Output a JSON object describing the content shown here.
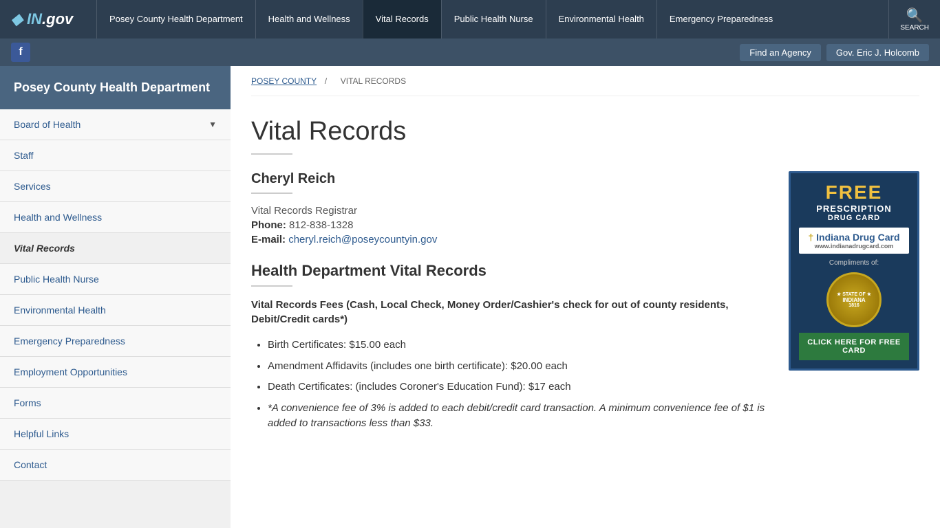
{
  "site": {
    "logo": "IN.gov",
    "logo_prefix": "IN",
    "logo_suffix": ".gov"
  },
  "top_nav": {
    "items": [
      {
        "label": "Posey County Health Department",
        "active": false
      },
      {
        "label": "Health and Wellness",
        "active": false
      },
      {
        "label": "Vital Records",
        "active": true
      },
      {
        "label": "Public Health Nurse",
        "active": false
      },
      {
        "label": "Environmental Health",
        "active": false
      },
      {
        "label": "Emergency Preparedness",
        "active": false
      }
    ],
    "search_label": "SEARCH"
  },
  "secondary_nav": {
    "facebook_label": "f",
    "find_agency": "Find an Agency",
    "governor": "Gov. Eric J. Holcomb"
  },
  "sidebar": {
    "title": "Posey County Health Department",
    "items": [
      {
        "label": "Board of Health",
        "active": false,
        "has_chevron": true
      },
      {
        "label": "Staff",
        "active": false,
        "has_chevron": false
      },
      {
        "label": "Services",
        "active": false,
        "has_chevron": false
      },
      {
        "label": "Health and Wellness",
        "active": false,
        "has_chevron": false
      },
      {
        "label": "Vital Records",
        "active": true,
        "has_chevron": false
      },
      {
        "label": "Public Health Nurse",
        "active": false,
        "has_chevron": false
      },
      {
        "label": "Environmental Health",
        "active": false,
        "has_chevron": false
      },
      {
        "label": "Emergency Preparedness",
        "active": false,
        "has_chevron": false
      },
      {
        "label": "Employment Opportunities",
        "active": false,
        "has_chevron": false
      },
      {
        "label": "Forms",
        "active": false,
        "has_chevron": false
      },
      {
        "label": "Helpful Links",
        "active": false,
        "has_chevron": false
      },
      {
        "label": "Contact",
        "active": false,
        "has_chevron": false
      }
    ]
  },
  "breadcrumb": {
    "parent": "POSEY COUNTY",
    "separator": "/",
    "current": "VITAL RECORDS"
  },
  "page": {
    "title": "Vital Records",
    "contact_name": "Cheryl Reich",
    "contact_title": "Vital Records Registrar",
    "contact_phone_label": "Phone:",
    "contact_phone": "812-838-1328",
    "contact_email_label": "E-mail:",
    "contact_email": "cheryl.reich@poseycountyin.gov",
    "section2_title": "Health Department Vital Records",
    "fees_note": "Vital Records Fees (Cash, Local Check, Money Order/Cashier's check for out of county residents, Debit/Credit cards*)",
    "fee_items": [
      {
        "text": "Birth Certificates: $15.00 each",
        "italic": false
      },
      {
        "text": "Amendment Affidavits (includes one birth certificate): $20.00 each",
        "italic": false
      },
      {
        "text": "Death Certificates: (includes Coroner's Education Fund): $17 each",
        "italic": false
      },
      {
        "text": "*A convenience fee of 3% is added to each debit/credit card transaction. A minimum convenience fee of $1 is added to transactions less than $33.",
        "italic": true
      }
    ]
  },
  "ad": {
    "free_label": "FREE",
    "prescription_label": "PRESCRIPTION",
    "drug_card_label": "DRUG CARD",
    "logo_name": "Indiana Drug Card",
    "logo_url_text": "www.indianadrugcard.com",
    "compliments_label": "Compliments of:",
    "seal_text": "STATE OF INDIANA 1816",
    "cta_label": "CLICK HERE FOR FREE CARD"
  }
}
